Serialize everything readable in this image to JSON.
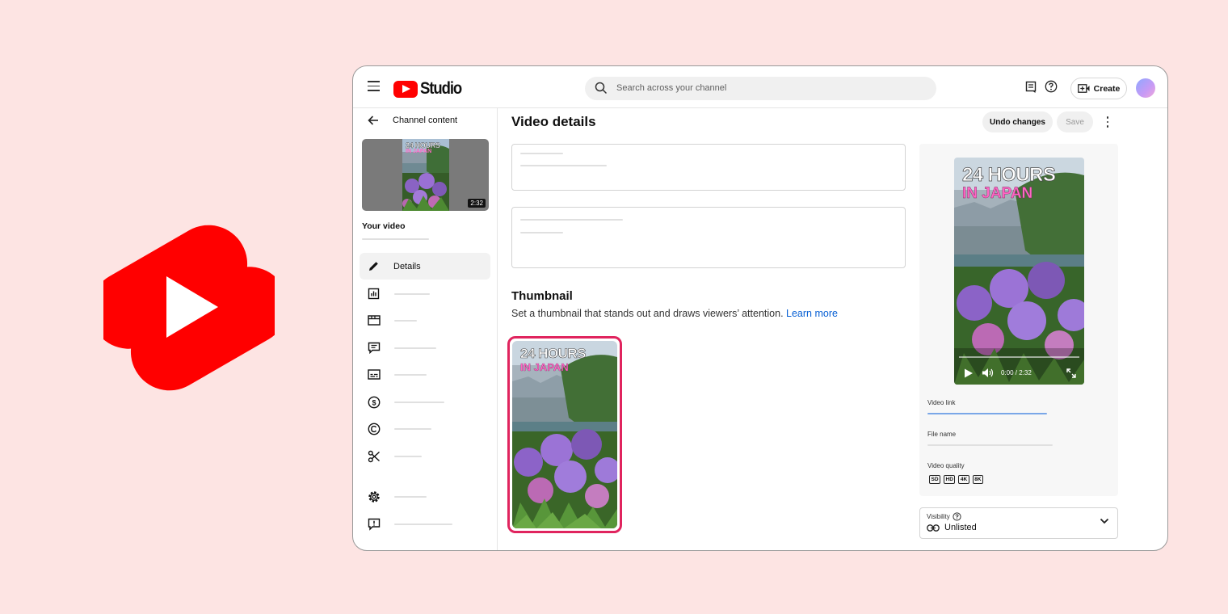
{
  "brand": {
    "shorts_logo_color": "#ff0000",
    "studio_label": "Studio"
  },
  "header": {
    "search_placeholder": "Search across your channel",
    "create_label": "Create"
  },
  "sidebar": {
    "back_label": "Channel content",
    "thumb_duration": "2:32",
    "your_video_label": "Your video",
    "active_item": "Details",
    "items": [
      {
        "icon": "pencil-icon",
        "label": "Details"
      },
      {
        "icon": "analytics-icon",
        "label": ""
      },
      {
        "icon": "editor-icon",
        "label": ""
      },
      {
        "icon": "comments-icon",
        "label": ""
      },
      {
        "icon": "subtitles-icon",
        "label": ""
      },
      {
        "icon": "monetization-icon",
        "label": ""
      },
      {
        "icon": "copyright-icon",
        "label": ""
      },
      {
        "icon": "clips-icon",
        "label": ""
      },
      {
        "icon": "settings-icon",
        "label": ""
      },
      {
        "icon": "feedback-icon",
        "label": ""
      }
    ]
  },
  "main": {
    "title": "Video details",
    "undo_label": "Undo changes",
    "save_label": "Save",
    "thumbnail_heading": "Thumbnail",
    "thumbnail_sub": "Set a thumbnail that stands out and draws viewers’ attention.",
    "learn_more": "Learn more",
    "thumbnail_text_line1": "24 HOURS",
    "thumbnail_text_line2": "IN JAPAN",
    "selected_border_color": "#e0245e"
  },
  "preview": {
    "text_line1": "24 HOURS",
    "text_line2": "IN JAPAN",
    "time": "0:00 / 2:32",
    "video_link_label": "Video link",
    "file_name_label": "File name",
    "video_quality_label": "Video quality",
    "qualities": [
      "SD",
      "HD",
      "4K",
      "8K"
    ]
  },
  "visibility": {
    "label": "Visibility",
    "value": "Unlisted"
  },
  "colors": {
    "background": "#fde4e3",
    "link": "#065fd4",
    "thumb_text": "#ff66c4"
  }
}
